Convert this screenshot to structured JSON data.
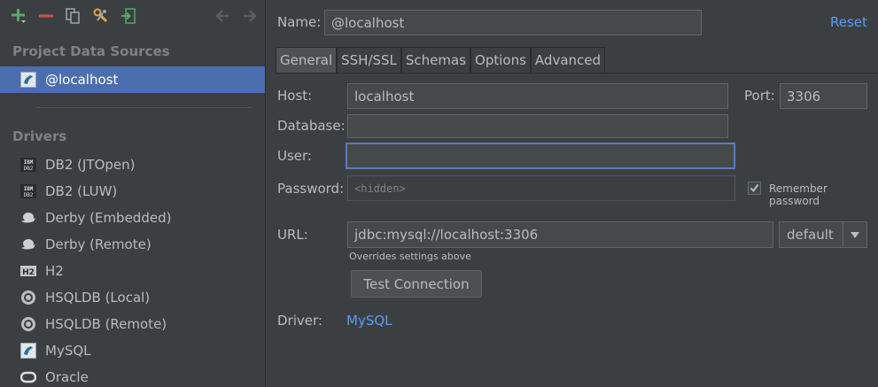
{
  "toolbar": {
    "add_icon": "plus-icon",
    "remove_icon": "minus-icon",
    "duplicate_icon": "copy-icon",
    "driver_settings_icon": "wrench-icon",
    "import_icon": "import-icon",
    "back_icon": "arrow-left-icon",
    "forward_icon": "arrow-right-icon"
  },
  "sidebar": {
    "project_heading": "Project Data Sources",
    "project_items": [
      {
        "label": "@localhost",
        "icon": "mysql-icon",
        "selected": true
      }
    ],
    "drivers_heading": "Drivers",
    "drivers": [
      {
        "label": "DB2 (JTOpen)",
        "icon": "ibm-db2-icon"
      },
      {
        "label": "DB2 (LUW)",
        "icon": "ibm-db2-icon"
      },
      {
        "label": "Derby (Embedded)",
        "icon": "derby-hat-icon"
      },
      {
        "label": "Derby (Remote)",
        "icon": "derby-hat-icon"
      },
      {
        "label": "H2",
        "icon": "h2-icon"
      },
      {
        "label": "HSQLDB (Local)",
        "icon": "hsqldb-icon"
      },
      {
        "label": "HSQLDB (Remote)",
        "icon": "hsqldb-icon"
      },
      {
        "label": "MySQL",
        "icon": "mysql-icon"
      },
      {
        "label": "Oracle",
        "icon": "oracle-icon"
      }
    ]
  },
  "form": {
    "name_label": "Name:",
    "name_value": "@localhost",
    "reset_label": "Reset",
    "tabs": [
      {
        "label": "General",
        "active": true
      },
      {
        "label": "SSH/SSL",
        "active": false
      },
      {
        "label": "Schemas",
        "active": false
      },
      {
        "label": "Options",
        "active": false
      },
      {
        "label": "Advanced",
        "active": false
      }
    ],
    "host_label": "Host:",
    "host_value": "localhost",
    "port_label": "Port:",
    "port_value": "3306",
    "database_label": "Database:",
    "database_value": "",
    "user_label": "User:",
    "user_value": "",
    "password_label": "Password:",
    "password_placeholder": "<hidden>",
    "remember_password_label": "Remember password",
    "remember_password_checked": true,
    "url_label": "URL:",
    "url_value": "jdbc:mysql://localhost:3306",
    "url_mode": "default",
    "url_hint": "Overrides settings above",
    "test_connection_label": "Test Connection",
    "driver_label": "Driver:",
    "driver_value": "MySQL"
  },
  "colors": {
    "background": "#3c3f41",
    "selection": "#4b6eaf",
    "link": "#589df6",
    "add_green": "#59a869",
    "remove_red": "#c75450"
  }
}
